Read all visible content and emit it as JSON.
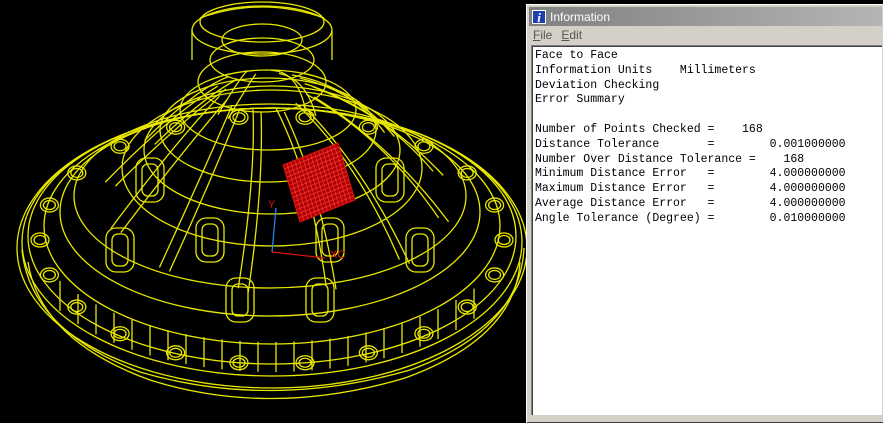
{
  "window": {
    "title": "Information",
    "title_icon": "i"
  },
  "menu": [
    {
      "label": "File",
      "accelerator": "F",
      "rest": "ile"
    },
    {
      "label": "Edit",
      "accelerator": "E",
      "rest": "dit"
    }
  ],
  "report": {
    "lines": [
      "Face to Face",
      "Information Units    Millimeters",
      "Deviation Checking",
      "Error Summary",
      "",
      "Number of Points Checked =    168",
      "Distance Tolerance       =        0.001000000",
      "Number Over Distance Tolerance =    168",
      "Minimum Distance Error   =        4.000000000",
      "Maximum Distance Error   =        4.000000000",
      "Average Distance Error   =        4.000000000",
      "Angle Tolerance (Degree) =        0.010000000"
    ]
  },
  "viewport": {
    "axis_labels": {
      "x": "XC",
      "y": "Y"
    },
    "colors": {
      "background": "#000000",
      "wireframe": "#e8e800",
      "highlight": "#e01010",
      "axis_y": "#2b8cff"
    }
  }
}
